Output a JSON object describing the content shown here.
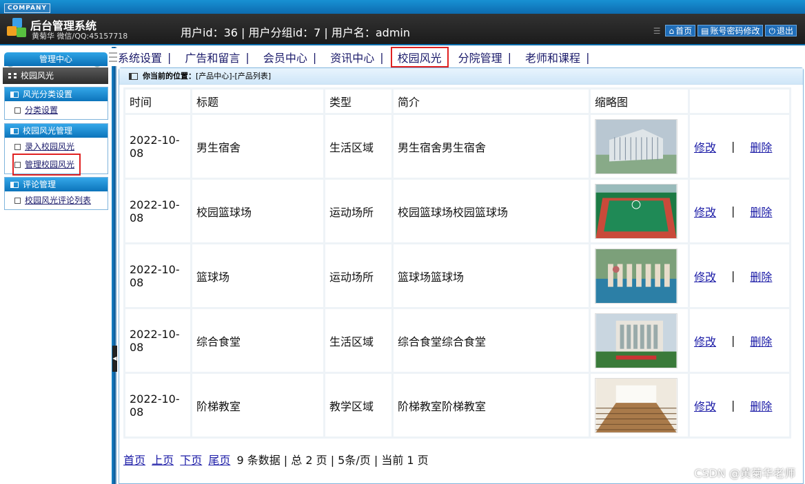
{
  "header": {
    "company": "COMPANY",
    "title": "后台管理系统",
    "subtitle": "黄菊华 微信/QQ:45157718",
    "user_info": "用户id：36 | 用户分组id：7 | 用户名：admin",
    "links": [
      "首页",
      "账号密码修改",
      "退出"
    ]
  },
  "sidebar": {
    "head": "管理中心",
    "current": "校园风光",
    "groups": [
      {
        "title": "风光分类设置",
        "items": [
          "分类设置"
        ]
      },
      {
        "title": "校园风光管理",
        "items": [
          "录入校园风光",
          "管理校园风光"
        ]
      },
      {
        "title": "评论管理",
        "items": [
          "校园风光评论列表"
        ]
      }
    ]
  },
  "topnav": [
    "系统设置",
    "广告和留言",
    "会员中心",
    "资讯中心",
    "校园风光",
    "分院管理",
    "老师和课程"
  ],
  "main": {
    "crumb_label": "你当前的位置：",
    "crumb_path": "[产品中心]-[产品列表]",
    "columns": [
      "时间",
      "标题",
      "类型",
      "简介",
      "缩略图",
      ""
    ],
    "rows": [
      {
        "date": "2022-10-08",
        "title": "男生宿舍",
        "type": "生活区域",
        "intro": "男生宿舍男生宿舍"
      },
      {
        "date": "2022-10-08",
        "title": "校园篮球场",
        "type": "运动场所",
        "intro": "校园篮球场校园篮球场"
      },
      {
        "date": "2022-10-08",
        "title": "篮球场",
        "type": "运动场所",
        "intro": "篮球场篮球场"
      },
      {
        "date": "2022-10-08",
        "title": "综合食堂",
        "type": "生活区域",
        "intro": "综合食堂综合食堂"
      },
      {
        "date": "2022-10-08",
        "title": "阶梯教室",
        "type": "教学区域",
        "intro": "阶梯教室阶梯教室"
      }
    ],
    "edit_label": "修改",
    "op_sep": "|",
    "delete_label": "删除",
    "pager": {
      "first": "首页",
      "prev": "上页",
      "next": "下页",
      "last": "尾页",
      "info": "9 条数据 | 总 2 页 | 5条/页 | 当前 1 页"
    }
  },
  "watermark": "CSDN @黄菊华老师",
  "colors": {
    "accent": "#0c74bb",
    "highlight": "#e02020",
    "link": "#1a1aa6"
  }
}
